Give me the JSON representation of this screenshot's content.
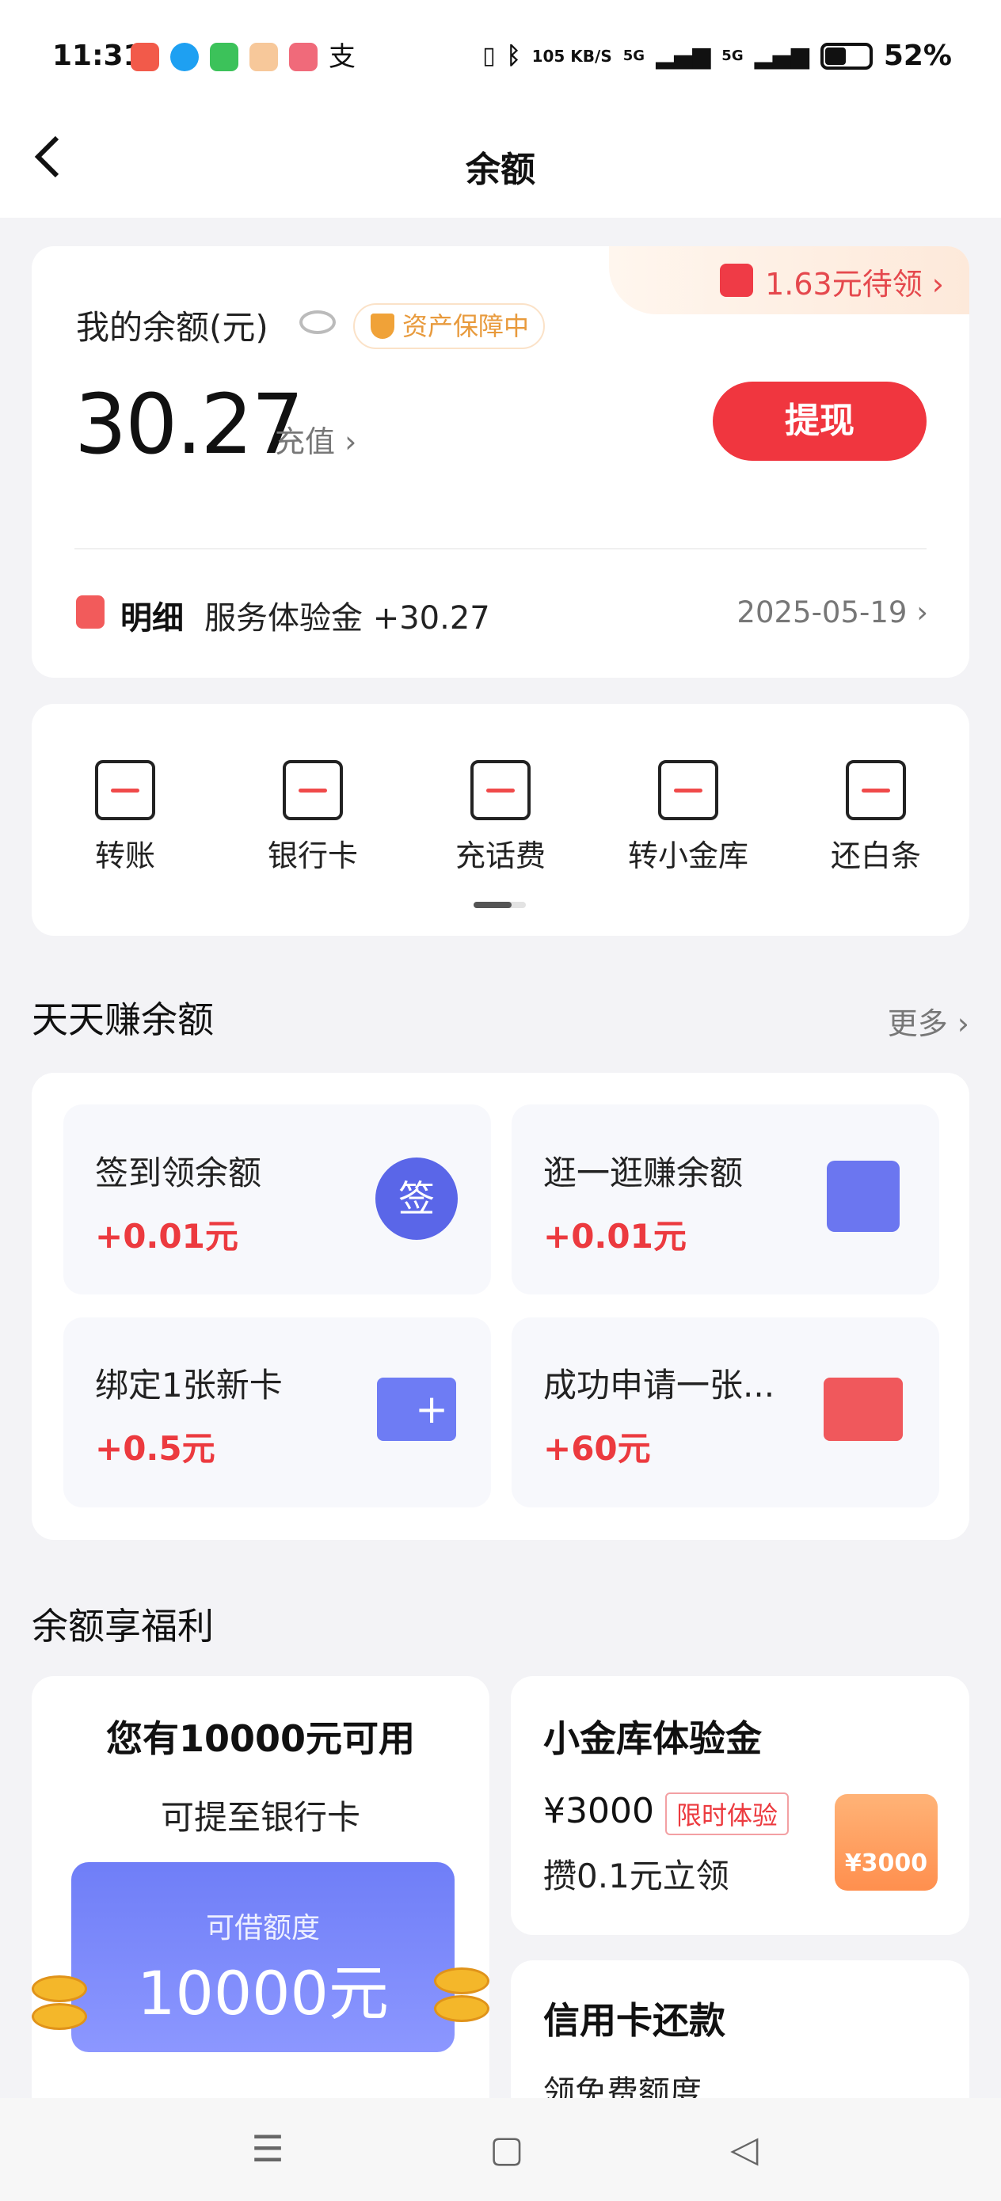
{
  "status_bar": {
    "time": "11:31",
    "network_speed": "105 KB/S",
    "network_1": "5G",
    "network_2": "5G",
    "battery": "52%"
  },
  "header": {
    "title": "余额",
    "back_icon": "chevron-left-icon"
  },
  "balance": {
    "label": "我的余额(元)",
    "safe_badge": "资产保障中",
    "amount": "30.27",
    "recharge": "充值",
    "withdraw": "提现",
    "red_packet": "1.63元待领",
    "detail_label": "明细",
    "detail_text": "服务体验金 +30.27",
    "detail_date": "2025-05-19"
  },
  "actions": [
    {
      "label": "转账",
      "icon": "transfer-icon"
    },
    {
      "label": "银行卡",
      "icon": "bank-card-icon"
    },
    {
      "label": "充话费",
      "icon": "phone-bill-icon"
    },
    {
      "label": "转小金库",
      "icon": "vault-transfer-icon"
    },
    {
      "label": "还白条",
      "icon": "repay-icon"
    }
  ],
  "earn": {
    "title": "天天赚余额",
    "more": "更多",
    "tiles": [
      {
        "title": "签到领余额",
        "reward": "+0.01元",
        "icon_text": "签"
      },
      {
        "title": "逛一逛赚余额",
        "reward": "+0.01元"
      },
      {
        "title": "绑定1张新卡",
        "reward": "+0.5元"
      },
      {
        "title": "成功申请一张...",
        "reward": "+60元"
      }
    ]
  },
  "welfare": {
    "title": "余额享福利",
    "left": {
      "title": "您有10000元可用",
      "subtitle": "可提至银行卡",
      "card_label": "可借额度",
      "card_amount": "10000元"
    },
    "vault": {
      "title": "小金库体验金",
      "amount": "¥3000",
      "tag": "限时体验",
      "desc": "攒0.1元立领",
      "icon_amount": "¥3000"
    },
    "credit": {
      "title": "信用卡还款",
      "desc": "领免费额度"
    }
  },
  "colors": {
    "accent_red": "#f0363f",
    "background": "#f3f3f6"
  }
}
